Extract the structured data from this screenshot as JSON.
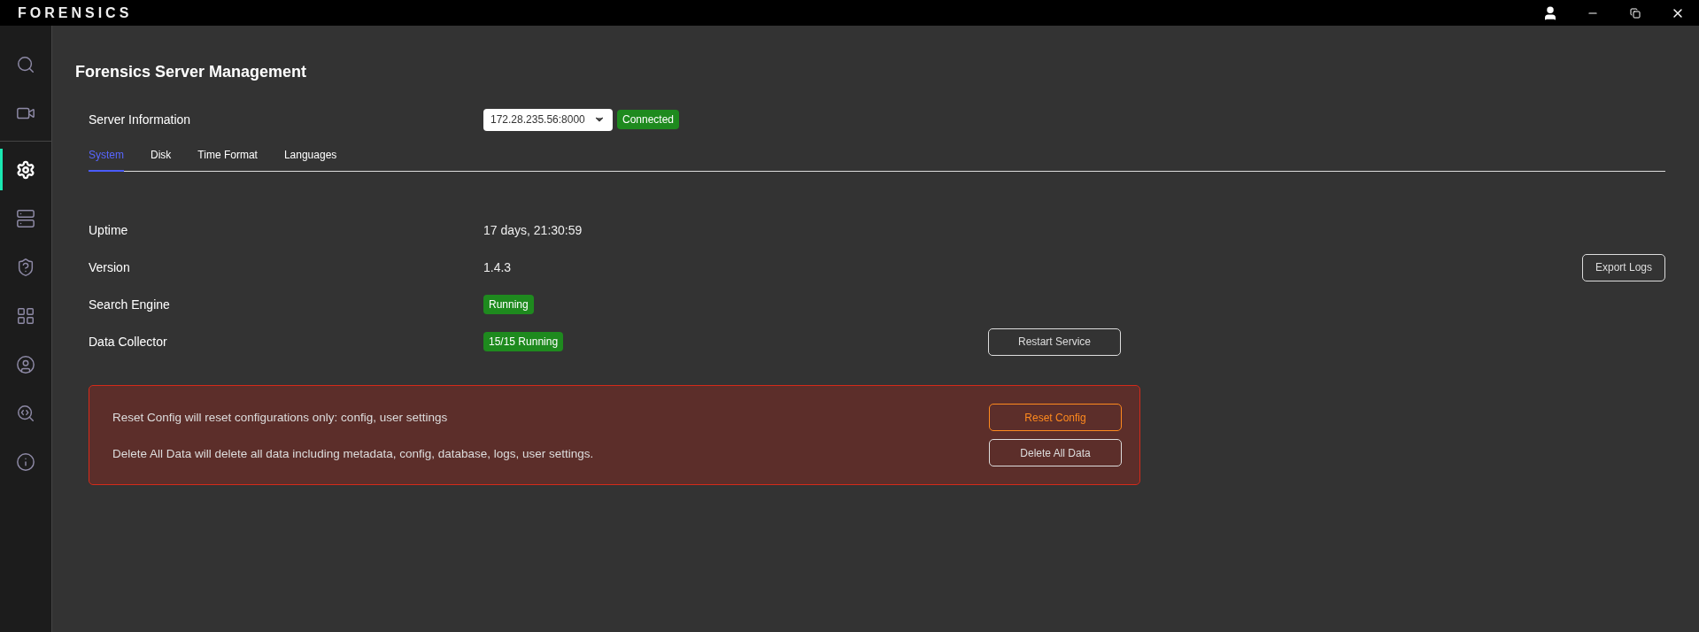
{
  "app": {
    "logo": "FORENSICS"
  },
  "sidebar": {
    "items": [
      {
        "selected": false
      },
      {
        "selected": false
      },
      {
        "selected": true
      },
      {
        "selected": false
      },
      {
        "selected": false
      },
      {
        "selected": false
      },
      {
        "selected": false
      },
      {
        "selected": false
      },
      {
        "selected": false
      }
    ]
  },
  "page": {
    "title": "Forensics Server Management"
  },
  "server": {
    "label": "Server Information",
    "address": "172.28.235.56:8000",
    "status": "Connected"
  },
  "tabs": [
    {
      "label": "System",
      "selected": true
    },
    {
      "label": "Disk",
      "selected": false
    },
    {
      "label": "Time Format",
      "selected": false
    },
    {
      "label": "Languages",
      "selected": false
    }
  ],
  "rows": [
    {
      "label": "Uptime",
      "kind": "text",
      "value": "17 days, 21:30:59"
    },
    {
      "label": "Version",
      "kind": "text",
      "value": "1.4.3"
    },
    {
      "label": "Search Engine",
      "kind": "badge",
      "value": "Running"
    },
    {
      "label": "Data Collector",
      "kind": "badge",
      "value": "15/15 Running"
    }
  ],
  "actions": {
    "export": "Export Logs",
    "restart": "Restart Service"
  },
  "danger": {
    "lines": [
      "Reset Config will reset configurations only: config, user settings",
      "Delete All Data will delete all data including metadata, config, database, logs, user settings."
    ],
    "buttons": [
      {
        "label": "Reset Config",
        "kind": "warning"
      },
      {
        "label": "Delete All Data",
        "kind": "plain"
      }
    ]
  }
}
